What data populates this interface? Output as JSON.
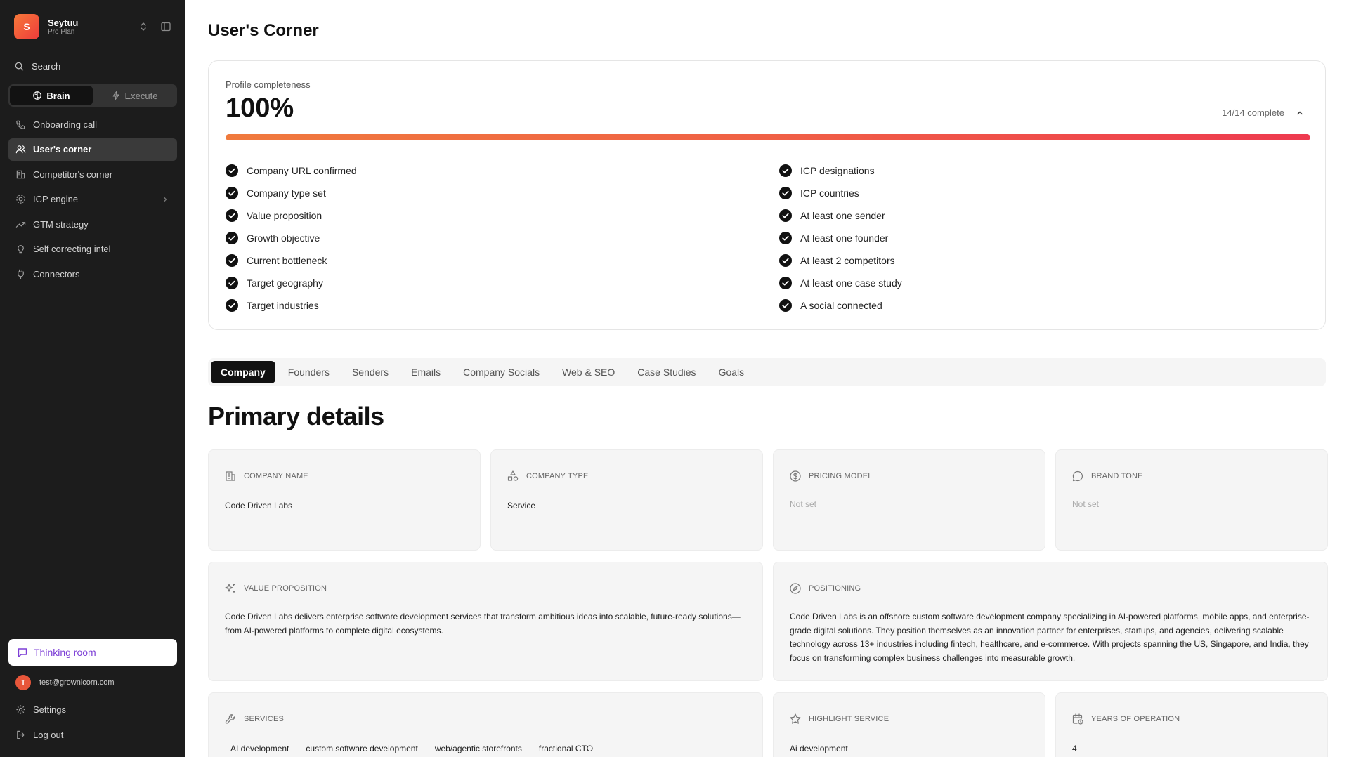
{
  "workspace": {
    "initial": "S",
    "name": "Seytuu",
    "plan": "Pro Plan"
  },
  "search": {
    "label": "Search"
  },
  "mode_switch": {
    "brain": "Brain",
    "execute": "Execute",
    "active": "Brain"
  },
  "nav": {
    "items": [
      {
        "label": "Onboarding call",
        "icon": "phone-icon"
      },
      {
        "label": "User's corner",
        "icon": "users-icon",
        "active": true
      },
      {
        "label": "Competitor's corner",
        "icon": "building-icon"
      },
      {
        "label": "ICP engine",
        "icon": "target-icon",
        "has_submenu": true
      },
      {
        "label": "GTM strategy",
        "icon": "trending-up-icon"
      },
      {
        "label": "Self correcting intel",
        "icon": "lightbulb-icon"
      },
      {
        "label": "Connectors",
        "icon": "plug-icon"
      }
    ]
  },
  "thinking_room": {
    "label": "Thinking room"
  },
  "user": {
    "initial": "T",
    "email": "test@grownicorn.com"
  },
  "bottom_nav": {
    "settings": "Settings",
    "logout": "Log out"
  },
  "page": {
    "title": "User's Corner"
  },
  "profile": {
    "label": "Profile completeness",
    "percent": "100%",
    "progress_fraction": 1.0,
    "count": "14/14 complete",
    "checks_left": [
      "Company URL confirmed",
      "Company type set",
      "Value proposition",
      "Growth objective",
      "Current bottleneck",
      "Target geography",
      "Target industries"
    ],
    "checks_right": [
      "ICP designations",
      "ICP countries",
      "At least one sender",
      "At least one founder",
      "At least 2 competitors",
      "At least one case study",
      "A social connected"
    ]
  },
  "tabs": [
    "Company",
    "Founders",
    "Senders",
    "Emails",
    "Company Socials",
    "Web & SEO",
    "Case Studies",
    "Goals"
  ],
  "active_tab": "Company",
  "section": {
    "title": "Primary details"
  },
  "cards": {
    "company_name": {
      "label": "COMPANY NAME",
      "value": "Code Driven Labs"
    },
    "company_type": {
      "label": "COMPANY TYPE",
      "value": "Service"
    },
    "pricing_model": {
      "label": "PRICING MODEL",
      "value": "Not set"
    },
    "brand_tone": {
      "label": "BRAND TONE",
      "value": "Not set"
    },
    "value_proposition": {
      "label": "VALUE PROPOSITION",
      "value": "Code Driven Labs delivers enterprise software development services that transform ambitious ideas into scalable, future-ready solutions—from AI-powered platforms to complete digital ecosystems."
    },
    "positioning": {
      "label": "POSITIONING",
      "value": "Code Driven Labs is an offshore custom software development company specializing in AI-powered platforms, mobile apps, and enterprise-grade digital solutions. They position themselves as an innovation partner for enterprises, startups, and agencies, delivering scalable technology across 13+ industries including fintech, healthcare, and e-commerce. With projects spanning the US, Singapore, and India, they focus on transforming complex business challenges into measurable growth."
    },
    "services": {
      "label": "SERVICES",
      "items": [
        "AI development",
        "custom software development",
        "web/agentic storefronts",
        "fractional CTO"
      ]
    },
    "highlight_service": {
      "label": "HIGHLIGHT SERVICE",
      "value": "Ai development"
    },
    "years_of_operation": {
      "label": "YEARS OF OPERATION",
      "value": "4"
    }
  },
  "colors": {
    "sidebar_bg": "#1c1c1c",
    "accent_orange": "#f07a3d",
    "accent_red": "#ee3a4f",
    "thinking_purple": "#7d3fd6"
  }
}
